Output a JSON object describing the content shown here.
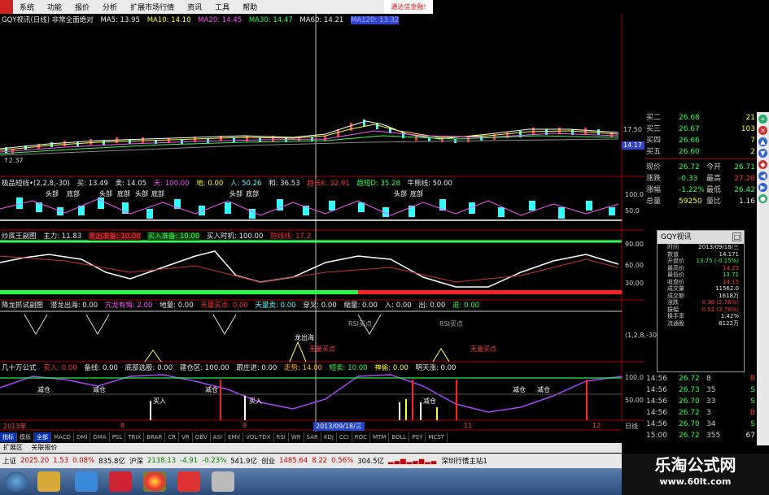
{
  "menu": [
    "系统",
    "功能",
    "报价",
    "分析",
    "扩展市场行情",
    "资讯",
    "工具",
    "帮助"
  ],
  "banner": "通达信金融!",
  "panel1": {
    "title": "GQY视讯(日线) 非常全面绝对",
    "ma5": "MA5: 13.95",
    "ma10": "MA10: 14.10",
    "ma20": "MA20: 14.45",
    "ma30": "MA30: 14.47",
    "ma60": "MA60: 14.21",
    "ma_extra": "MA120: 13.32",
    "price_labels": [
      "17.50",
      "14.17"
    ],
    "low_label": "↑2.37"
  },
  "panel2": {
    "title": "极品短线•(2,2,8,-30)",
    "items": [
      "买: 13.49",
      "卖: 14.05",
      "天: 100.00",
      "地: 0.00",
      "人: 50.26",
      "和: 36.53",
      "趋长K: 32.91",
      "趋短D: 35.28",
      "牛熊线: 50.00"
    ],
    "ticks": [
      "100.0",
      "50.0"
    ],
    "labels": [
      "头部",
      "底部",
      "头部",
      "底部",
      "头部",
      "底部",
      "头部",
      "底部",
      "头部",
      "底部"
    ]
  },
  "panel3": {
    "title": "炒底王副图",
    "items": [
      "主力: 11.83",
      "卖出准备: 10.00",
      "买入准备: 10.00",
      "买入时机: 100.00",
      "防线线: 17.2"
    ],
    "ticks": [
      "90.00",
      "60.00",
      "30.00"
    ]
  },
  "panel4": {
    "title": "降龙抓试副图",
    "items": [
      "潜龙出海: 0.00",
      "亢龙有悔: 2.00",
      "地量: 0.00",
      "天量买点: 0.00",
      "天量卖: 0.00",
      "穿叉: 0.00",
      "缩量: 0.00",
      "入: 0.00",
      "出: 0.00",
      "退: 0.00"
    ],
    "ticks": [
      "(1,2,8,-30)"
    ],
    "labels": [
      "RSI买点",
      "RSI买点",
      "无量买点",
      "无量买点",
      "龙出海"
    ]
  },
  "panel5": {
    "title": "几十万公式",
    "items": [
      "买入: 0.00",
      "备线: 0.00",
      "底部选股: 0.00",
      "建仓区: 100.00",
      "跟庄进: 0.00",
      "走势: 14.00",
      "短卖: 10.00",
      "神偷: 0.00",
      "明天涨: 0.00"
    ],
    "ticks": [
      "100.0",
      "50.00"
    ],
    "labels": [
      "减仓",
      "减仓",
      "减仓",
      "买入",
      "买入",
      "减仓",
      "减仓",
      "减仓"
    ]
  },
  "xaxis": [
    "2013年",
    "8",
    "9",
    "2013/09/18/三",
    "11",
    "12",
    "日线"
  ],
  "quote": {
    "bids": [
      {
        "l": "买二",
        "p": "26.68",
        "q": "21"
      },
      {
        "l": "买三",
        "p": "26.67",
        "q": "103"
      },
      {
        "l": "买四",
        "p": "26.66",
        "q": "7"
      },
      {
        "l": "买五",
        "p": "26.60",
        "q": "2"
      }
    ],
    "stats": [
      {
        "l": "现价",
        "v": "26.72",
        "l2": "今开",
        "v2": "26.71"
      },
      {
        "l": "涨跌",
        "v": "-0.33",
        "l2": "最高",
        "v2": "27.28"
      },
      {
        "l": "涨幅",
        "v": "-1.22%",
        "l2": "最低",
        "v2": "26.42"
      },
      {
        "l": "总量",
        "v": "59250",
        "l2": "量比",
        "v2": "1.16"
      }
    ],
    "ticks": [
      {
        "t": "14:56",
        "p": "26.72",
        "q": "8",
        "f": "B"
      },
      {
        "t": "14:56",
        "p": "26.73",
        "q": "35",
        "f": "S"
      },
      {
        "t": "14:56",
        "p": "26.70",
        "q": "33",
        "f": "S"
      },
      {
        "t": "14:56",
        "p": "26.72",
        "q": "3",
        "f": "B"
      },
      {
        "t": "14:56",
        "p": "26.70",
        "q": "34",
        "f": "S"
      },
      {
        "t": "15:00",
        "p": "26.72",
        "q": "355",
        "f": "67"
      }
    ]
  },
  "popup": {
    "title": "GQY视讯",
    "rows": [
      {
        "l": "时间",
        "v": "2013/09/18/三"
      },
      {
        "l": "数值",
        "v": "14.171"
      },
      {
        "l": "开盘价",
        "v": "13.75 (-0.15%)"
      },
      {
        "l": "最高价",
        "v": "14.23"
      },
      {
        "l": "最低价",
        "v": "13.71"
      },
      {
        "l": "收盘价",
        "v": "14.15"
      },
      {
        "l": "成交量",
        "v": "11562.0"
      },
      {
        "l": "成交额",
        "v": "1618万"
      },
      {
        "l": "涨跌",
        "v": "0.38 (2.76%)"
      },
      {
        "l": "振幅",
        "v": "0.52 (3.78%)"
      },
      {
        "l": "换手率",
        "v": "1.42%"
      },
      {
        "l": "流通股",
        "v": "8122万"
      }
    ]
  },
  "tabs": [
    "指标",
    "模板",
    "全部",
    "MACD",
    "DMI",
    "DMA",
    "PSL",
    "TRIX",
    "BRAR",
    "CR",
    "VR",
    "OBV",
    "ASI",
    "EMV",
    "VOL-TDX",
    "RSI",
    "WR",
    "SAR",
    "KDJ",
    "CCI",
    "ROC",
    "MTM",
    "BOLL",
    "PSY",
    "MCST"
  ],
  "tabs2": [
    "扩展区",
    "关联报价"
  ],
  "status": {
    "sh_label": "上证",
    "sh_val": "2025.20",
    "sh_chg": "1.53",
    "sh_pct": "0.08%",
    "sh_amt": "835.8亿",
    "sz_label": "沪深",
    "sz_val": "2138.13",
    "sz_chg": "-4.91",
    "sz_pct": "-0.23%",
    "sz_amt": "541.9亿",
    "cy_label": "创业",
    "cy_val": "1485.64",
    "cy_chg": "8.22",
    "cy_pct": "0.56%",
    "cy_amt": "304.5亿",
    "server": "深圳行情主站1"
  },
  "watermark": {
    "line1": "乐淘公式网",
    "line2": "www.60lt.com"
  }
}
